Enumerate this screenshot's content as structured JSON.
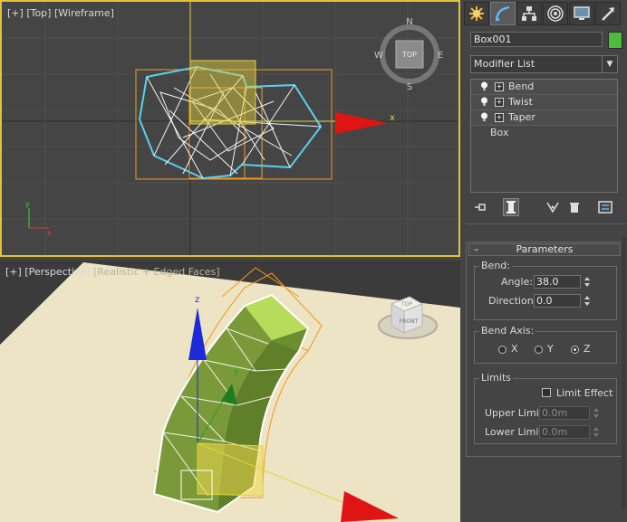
{
  "viewports": {
    "top": {
      "plus": "[+]",
      "view": "[Top]",
      "shading": "[Wireframe]",
      "axis_x": "x",
      "axis_y": "y",
      "compass": {
        "north": "N",
        "south": "S",
        "east": "E",
        "west": "W",
        "cube": "TOP"
      }
    },
    "perspective": {
      "plus": "[+]",
      "view": "[Perspective]",
      "shading": "[Realistic + Edged Faces]",
      "axis_x": "x",
      "axis_y": "y",
      "axis_z": "z",
      "viewcube": {
        "top": "TOP",
        "front": "FRONT"
      }
    }
  },
  "panel": {
    "tabs": [
      "create-icon",
      "modify-icon",
      "hierarchy-icon",
      "motion-icon",
      "display-icon",
      "utilities-icon"
    ],
    "object_name": "Box001",
    "object_color": "#4fbb3a",
    "modifier_list": "Modifier List",
    "stack": [
      {
        "label": "Bend",
        "type": "modifier"
      },
      {
        "label": "Twist",
        "type": "modifier"
      },
      {
        "label": "Taper",
        "type": "modifier"
      },
      {
        "label": "Box",
        "type": "base"
      }
    ],
    "parameters": {
      "title": "Parameters",
      "bend_group": "Bend:",
      "angle_label": "Angle:",
      "angle_value": "38.0",
      "direction_label": "Direction:",
      "direction_value": "0.0",
      "axis_group": "Bend Axis:",
      "axis_options": [
        "X",
        "Y",
        "Z"
      ],
      "axis_selected": "Z",
      "limits_group": "Limits",
      "limit_effect_label": "Limit Effect",
      "limit_effect_checked": false,
      "upper_label": "Upper Limit:",
      "upper_value": "0.0m",
      "lower_label": "Lower Limit:",
      "lower_value": "0.0m"
    }
  }
}
